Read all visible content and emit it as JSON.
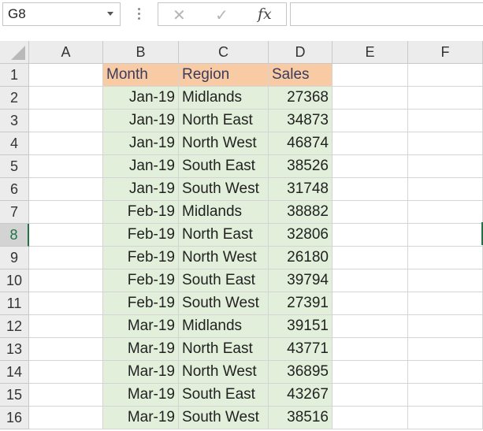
{
  "name_box": {
    "value": "G8"
  },
  "formula_bar": {
    "cancel_icon": "✕",
    "enter_icon": "✓",
    "fx_label": "fx",
    "content": ""
  },
  "columns": [
    "A",
    "B",
    "C",
    "D",
    "E",
    "F"
  ],
  "rows": [
    "1",
    "2",
    "3",
    "4",
    "5",
    "6",
    "7",
    "8",
    "9",
    "10",
    "11",
    "12",
    "13",
    "14",
    "15",
    "16"
  ],
  "active_row": "8",
  "table": {
    "headers": [
      "Month",
      "Region",
      "Sales"
    ],
    "rows": [
      [
        "Jan-19",
        "Midlands",
        "27368"
      ],
      [
        "Jan-19",
        "North East",
        "34873"
      ],
      [
        "Jan-19",
        "North West",
        "46874"
      ],
      [
        "Jan-19",
        "South East",
        "38526"
      ],
      [
        "Jan-19",
        "South West",
        "31748"
      ],
      [
        "Feb-19",
        "Midlands",
        "38882"
      ],
      [
        "Feb-19",
        "North East",
        "32806"
      ],
      [
        "Feb-19",
        "North West",
        "26180"
      ],
      [
        "Feb-19",
        "South East",
        "39794"
      ],
      [
        "Feb-19",
        "South West",
        "27391"
      ],
      [
        "Mar-19",
        "Midlands",
        "39151"
      ],
      [
        "Mar-19",
        "North East",
        "43771"
      ],
      [
        "Mar-19",
        "North West",
        "36895"
      ],
      [
        "Mar-19",
        "South East",
        "43267"
      ],
      [
        "Mar-19",
        "South West",
        "38516"
      ]
    ]
  },
  "colors": {
    "header_fill": "#f8cba4",
    "body_fill": "#e2efda",
    "excel_green": "#217346"
  }
}
